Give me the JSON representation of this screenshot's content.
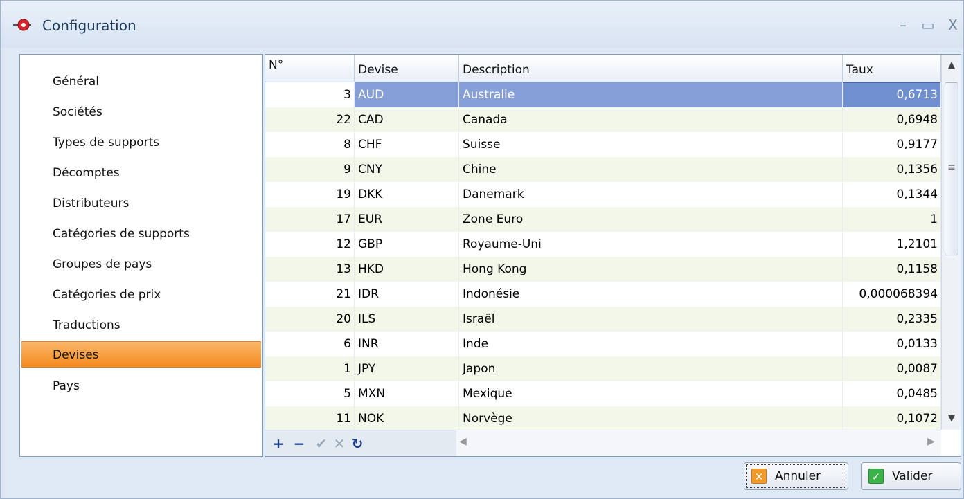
{
  "window": {
    "title": "Configuration",
    "controls": {
      "minimize": "–",
      "maximize": "▭",
      "close": "X"
    }
  },
  "sidebar": {
    "items": [
      {
        "label": "Général"
      },
      {
        "label": "Sociétés"
      },
      {
        "label": "Types de supports"
      },
      {
        "label": "Décomptes"
      },
      {
        "label": "Distributeurs"
      },
      {
        "label": "Catégories de supports"
      },
      {
        "label": "Groupes de pays"
      },
      {
        "label": "Catégories de prix"
      },
      {
        "label": "Traductions"
      },
      {
        "label": "Devises"
      },
      {
        "label": "Pays"
      }
    ],
    "selected": "Devises"
  },
  "grid": {
    "columns": {
      "num": "N°",
      "devise": "Devise",
      "description": "Description",
      "taux": "Taux"
    },
    "rows": [
      {
        "num": "3",
        "devise": "AUD",
        "description": "Australie",
        "taux": "0,6713"
      },
      {
        "num": "22",
        "devise": "CAD",
        "description": "Canada",
        "taux": "0,6948"
      },
      {
        "num": "8",
        "devise": "CHF",
        "description": "Suisse",
        "taux": "0,9177"
      },
      {
        "num": "9",
        "devise": "CNY",
        "description": "Chine",
        "taux": "0,1356"
      },
      {
        "num": "19",
        "devise": "DKK",
        "description": "Danemark",
        "taux": "0,1344"
      },
      {
        "num": "17",
        "devise": "EUR",
        "description": "Zone Euro",
        "taux": "1"
      },
      {
        "num": "12",
        "devise": "GBP",
        "description": "Royaume-Uni",
        "taux": "1,2101"
      },
      {
        "num": "13",
        "devise": "HKD",
        "description": "Hong Kong",
        "taux": "0,1158"
      },
      {
        "num": "21",
        "devise": "IDR",
        "description": "Indonésie",
        "taux": "0,000068394"
      },
      {
        "num": "20",
        "devise": "ILS",
        "description": "Israël",
        "taux": "0,2335"
      },
      {
        "num": "6",
        "devise": "INR",
        "description": "Inde",
        "taux": "0,0133"
      },
      {
        "num": "1",
        "devise": "JPY",
        "description": "Japon",
        "taux": "0,0087"
      },
      {
        "num": "5",
        "devise": "MXN",
        "description": "Mexique",
        "taux": "0,0485"
      },
      {
        "num": "11",
        "devise": "NOK",
        "description": "Norvège",
        "taux": "0,1072"
      }
    ],
    "navigator": {
      "add": "+",
      "delete": "−",
      "post": "✔",
      "cancel": "✕",
      "refresh": "↻"
    },
    "scroll": {
      "up": "▲",
      "down": "▼",
      "grip": "≡",
      "left": "◀",
      "right": "▶"
    }
  },
  "buttons": {
    "cancel": {
      "label": "Annuler",
      "icon": "✕"
    },
    "ok": {
      "label": "Valider",
      "icon": "✓"
    }
  },
  "colors": {
    "selection": "#8aa6dd",
    "active_nav": "#f48a1f"
  }
}
